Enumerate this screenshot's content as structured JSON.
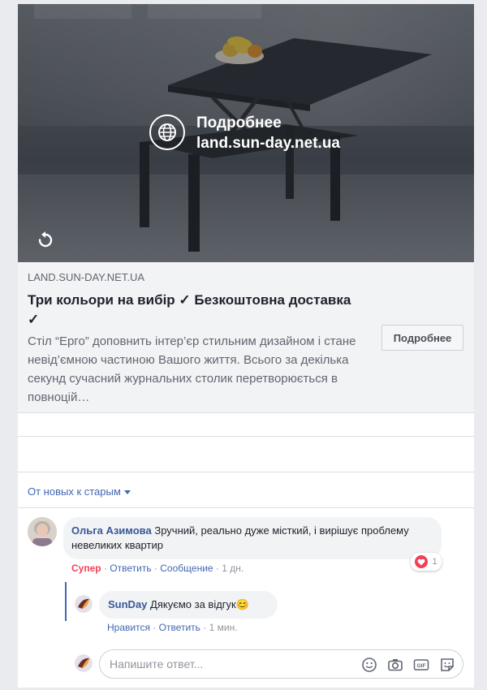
{
  "media": {
    "cta_title": "Подробнее",
    "cta_url": "land.sun-day.net.ua",
    "icons": {
      "globe": "globe-icon",
      "replay": "replay-icon"
    }
  },
  "link_preview": {
    "domain": "LAND.SUN-DAY.NET.UA",
    "headline": "Три кольори на вибір ✓ Безкоштовна доставка ✓",
    "description": "Стіл “Ерго” доповнить інтер’єр стильним дизайном і стане невід’ємною частиною Вашого життя. Всього за декілька секунд сучасний журнальних столик перетворюється в повноцій…",
    "button_label": "Подробнее"
  },
  "comments_sort": {
    "label": "От новых к старым"
  },
  "comment": {
    "author": "Ольга Азимова",
    "text": "Зручний, реально дуже місткий, і вирішує проблему невеликих квартир",
    "reaction_label": "Супер",
    "reply_label": "Ответить",
    "message_label": "Сообщение",
    "time": "1 дн.",
    "reaction_count": "1",
    "separator": "·"
  },
  "reply": {
    "author": "SunDay",
    "text": "Дякуємо за відгук",
    "emoji": "😊",
    "like_label": "Нравится",
    "reply_label": "Ответить",
    "time": "1 мин.",
    "separator": "·"
  },
  "reply_box": {
    "placeholder": "Напишите ответ...",
    "tools": [
      "emoji-icon",
      "camera-icon",
      "gif-icon",
      "sticker-icon"
    ],
    "gif_label": "GIF"
  },
  "colors": {
    "link_blue": "#4267b2",
    "author_blue": "#385898",
    "love_red": "#f33e58"
  }
}
